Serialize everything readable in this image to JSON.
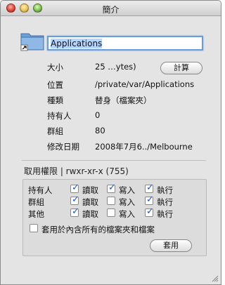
{
  "window": {
    "title": "簡介"
  },
  "name_field": {
    "value": "Applications"
  },
  "info": {
    "size_label": "大小",
    "size_value": "25 …ytes)",
    "compute_button": "計算",
    "location_label": "位置",
    "location_value": "/private/var/Applications",
    "kind_label": "種類",
    "kind_value": "替身（檔案夾）",
    "owner_label": "持有人",
    "owner_value": "0",
    "group_label": "群組",
    "group_value": "80",
    "modified_label": "修改日期",
    "modified_value": "2008年7月6../Melbourne"
  },
  "permissions": {
    "title": "取用權限 | rwxr-xr-x (755)",
    "rows": [
      {
        "label": "持有人",
        "read": "讀取",
        "write": "寫入",
        "exec": "執行",
        "read_on": true,
        "write_on": true,
        "exec_on": true
      },
      {
        "label": "群組",
        "read": "讀取",
        "write": "寫入",
        "exec": "執行",
        "read_on": true,
        "write_on": false,
        "exec_on": true
      },
      {
        "label": "其他",
        "read": "讀取",
        "write": "寫入",
        "exec": "執行",
        "read_on": true,
        "write_on": false,
        "exec_on": true
      }
    ],
    "apply_all_label": "套用於內含所有的檔案夾和檔案",
    "apply_all_checked": false,
    "apply_button": "套用"
  },
  "colors": {
    "accent": "#6b9dd9",
    "selection": "#b5d5ff",
    "check": "#1a56c4"
  }
}
